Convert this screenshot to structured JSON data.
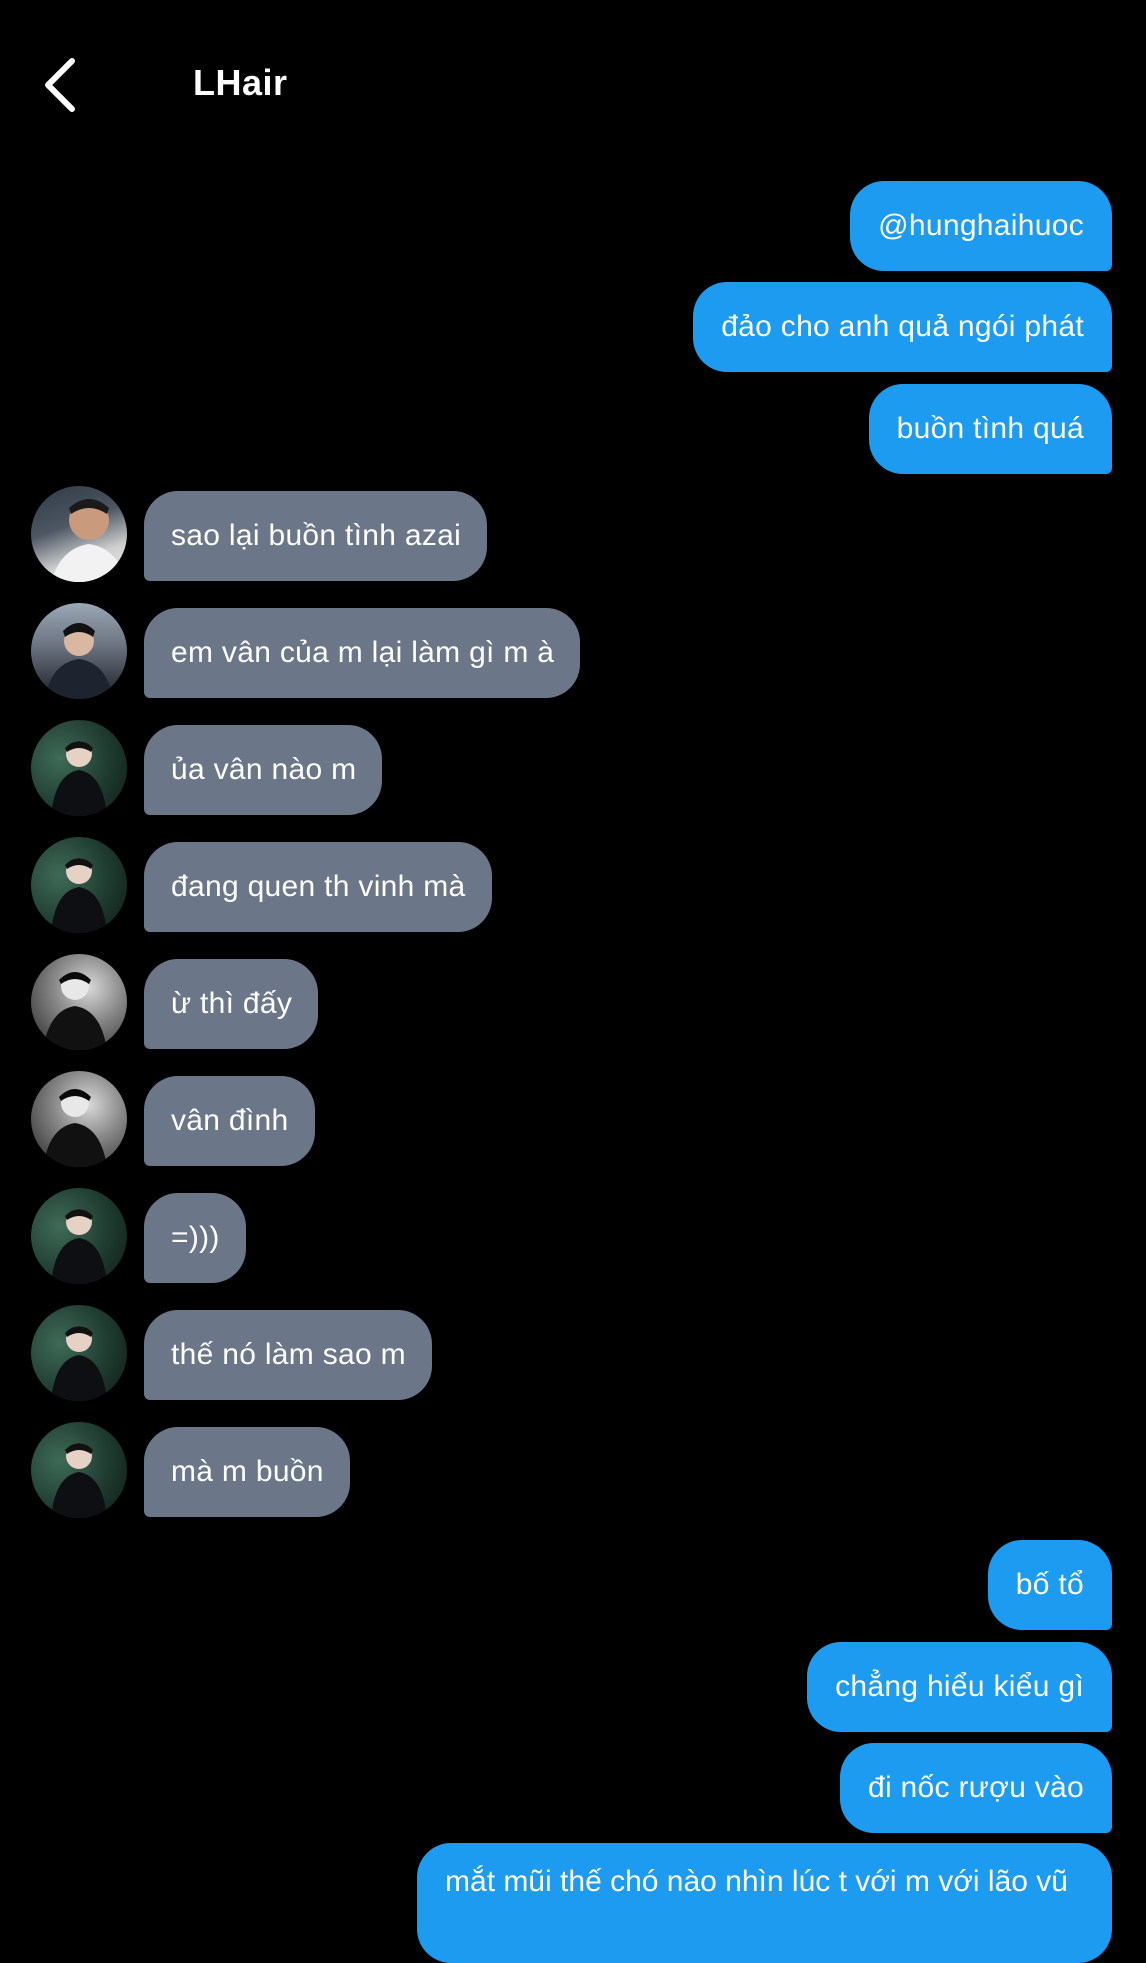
{
  "header": {
    "title": "LHair"
  },
  "messages": {
    "m1": "@hunghaihuoc",
    "m2": "đảo cho anh quả ngói phát",
    "m3": "buồn tình quá",
    "m4": "sao lại buồn tình azai",
    "m5": "em vân của m lại làm gì m à",
    "m6": "ủa vân nào m",
    "m7": "đang quen th vinh mà",
    "m8": "ừ thì đấy",
    "m9": "vân đình",
    "m10": "=)))",
    "m11": "thế nó làm sao m",
    "m12": "mà m buồn",
    "m13": "bố tổ",
    "m14": "chẳng hiểu kiểu gì",
    "m15": "đi nốc rượu vào",
    "m16": "mắt mũi thế chó nào nhìn lúc t với m với lão vũ"
  },
  "colors": {
    "outgoing_bubble": "#1d9bf0",
    "incoming_bubble": "#6b7788",
    "background": "#000000"
  },
  "icons": {
    "back": "chevron-left-icon",
    "avatar": "avatar"
  }
}
